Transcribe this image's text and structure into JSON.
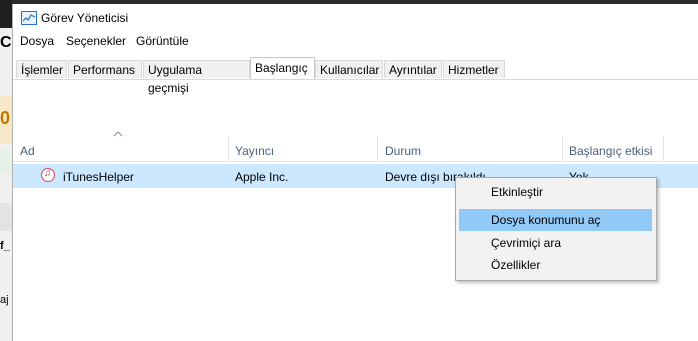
{
  "window": {
    "title": "Görev Yöneticisi"
  },
  "background_strip": {
    "partial_letter_1": "C",
    "partial_value": "0",
    "partial_letter_2": "f_",
    "partial_letter_3": "aj"
  },
  "menu": [
    "Dosya",
    "Seçenekler",
    "Görüntüle"
  ],
  "tabs": [
    {
      "label": "İşlemler",
      "active": false
    },
    {
      "label": "Performans",
      "active": false
    },
    {
      "label": "Uygulama geçmişi",
      "active": false
    },
    {
      "label": "Başlangıç",
      "active": true
    },
    {
      "label": "Kullanıcılar",
      "active": false
    },
    {
      "label": "Ayrıntılar",
      "active": false
    },
    {
      "label": "Hizmetler",
      "active": false
    }
  ],
  "table": {
    "columns": [
      "Ad",
      "Yayıncı",
      "Durum",
      "Başlangıç etkisi"
    ],
    "sorted_column": "Ad",
    "rows": [
      {
        "name": "iTunesHelper",
        "publisher": "Apple Inc.",
        "status": "Devre dışı bırakıldı",
        "impact": "Yok",
        "icon": "itunes-icon",
        "selected": true
      }
    ]
  },
  "context_menu": {
    "items": [
      {
        "label": "Etkinleştir",
        "highlighted": false
      },
      {
        "label": "Dosya konumunu aç",
        "highlighted": true
      },
      {
        "label": "Çevrimiçi ara",
        "highlighted": false
      },
      {
        "label": "Özellikler",
        "highlighted": false
      }
    ]
  },
  "colors": {
    "selection": "#cce8ff",
    "menu_highlight": "#91c9f7",
    "header_text": "#4c607a"
  }
}
